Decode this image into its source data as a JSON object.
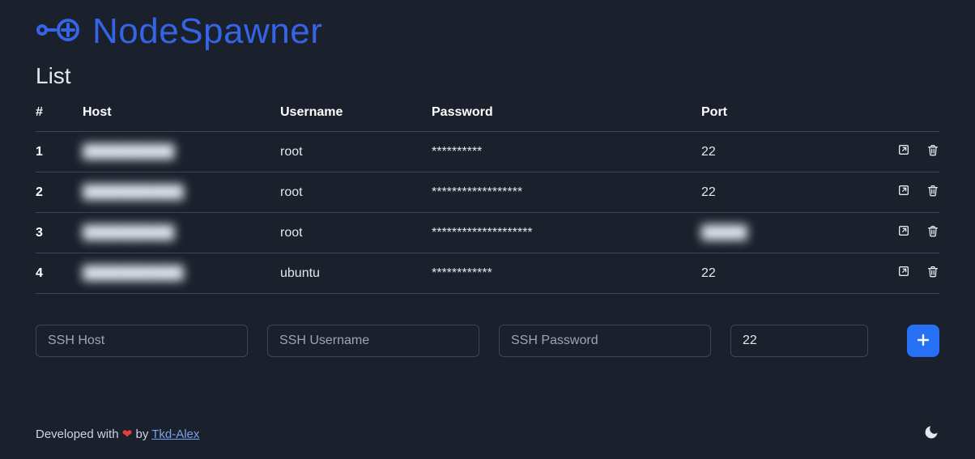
{
  "app_title": "NodeSpawner",
  "page_title": "List",
  "table": {
    "headers": {
      "num": "#",
      "host": "Host",
      "username": "Username",
      "password": "Password",
      "port": "Port"
    },
    "rows": [
      {
        "idx": "1",
        "host": "██████████",
        "host_redacted": true,
        "username": "root",
        "password": "**********",
        "port": "22",
        "port_redacted": false
      },
      {
        "idx": "2",
        "host": "███████████",
        "host_redacted": true,
        "username": "root",
        "password": "******************",
        "port": "22",
        "port_redacted": false
      },
      {
        "idx": "3",
        "host": "██████████",
        "host_redacted": true,
        "username": "root",
        "password": "********************",
        "port": "█████",
        "port_redacted": true
      },
      {
        "idx": "4",
        "host": "███████████",
        "host_redacted": true,
        "username": "ubuntu",
        "password": "************",
        "port": "22",
        "port_redacted": false
      }
    ]
  },
  "form": {
    "host_placeholder": "SSH Host",
    "user_placeholder": "SSH Username",
    "pass_placeholder": "SSH Password",
    "port_value": "22"
  },
  "footer": {
    "prefix": "Developed with ",
    "by": " by ",
    "author": "Tkd-Alex"
  },
  "icons": {
    "open": "open-in-new-icon",
    "delete": "trash-icon",
    "add": "plus-icon",
    "theme": "moon-icon",
    "heart": "heart-icon",
    "logo": "logo-icon"
  }
}
